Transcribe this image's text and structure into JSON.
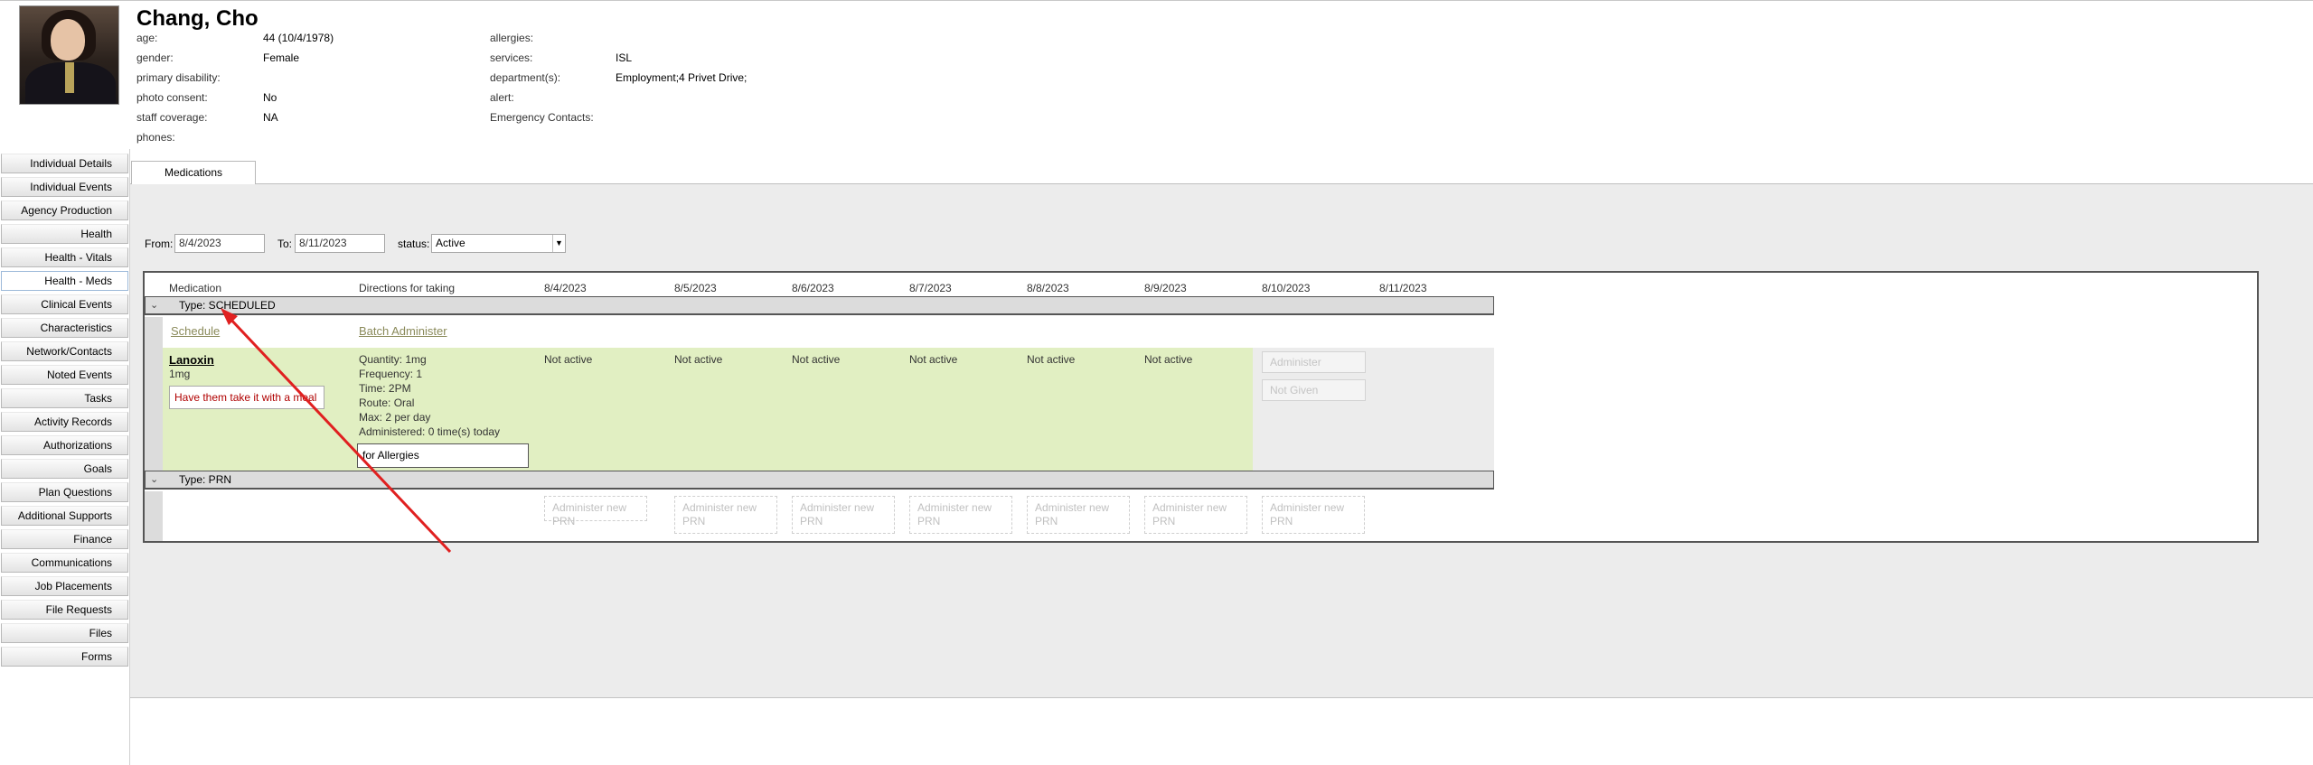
{
  "patient": {
    "name": "Chang, Cho",
    "fields_left": [
      {
        "label": "age:",
        "value": "44 (10/4/1978)"
      },
      {
        "label": "gender:",
        "value": "Female"
      },
      {
        "label": "primary disability:",
        "value": ""
      },
      {
        "label": "photo consent:",
        "value": "No"
      },
      {
        "label": "staff coverage:",
        "value": "NA"
      },
      {
        "label": "phones:",
        "value": ""
      }
    ],
    "fields_right": [
      {
        "label": "allergies:",
        "value": ""
      },
      {
        "label": "services:",
        "value": "ISL"
      },
      {
        "label": "department(s):",
        "value": "Employment;4 Privet Drive;"
      },
      {
        "label": "alert:",
        "value": ""
      },
      {
        "label": "Emergency Contacts:",
        "value": ""
      }
    ]
  },
  "nav": [
    "Individual Details",
    "Individual Events",
    "Agency Production",
    "Health",
    "Health - Vitals",
    "Health - Meds",
    "Clinical Events",
    "Characteristics",
    "Network/Contacts",
    "Noted Events",
    "Tasks",
    "Activity Records",
    "Authorizations",
    "Goals",
    "Plan Questions",
    "Additional Supports",
    "Finance",
    "Communications",
    "Job Placements",
    "File Requests",
    "Files",
    "Forms"
  ],
  "active_nav": "Health - Meds",
  "tab": {
    "label": "Medications"
  },
  "filters": {
    "from_label": "From:",
    "from_value": "8/4/2023",
    "to_label": "To:",
    "to_value": "8/11/2023",
    "status_label": "status:",
    "status_value": "Active"
  },
  "grid": {
    "columns": {
      "medication": "Medication",
      "directions": "Directions for taking"
    },
    "dates": [
      "8/4/2023",
      "8/5/2023",
      "8/6/2023",
      "8/7/2023",
      "8/8/2023",
      "8/9/2023",
      "8/10/2023",
      "8/11/2023"
    ],
    "group_scheduled": "Type: SCHEDULED",
    "schedule_link": "Schedule",
    "batch_link": "Batch Administer",
    "medication": {
      "name": "Lanoxin",
      "dose": "1mg",
      "note": "Have them take it with a meal",
      "directions": [
        "Quantity: 1mg",
        "Frequency: 1",
        "Time: 2PM",
        "Route: Oral",
        "Max: 2 per day",
        "Administered: 0 time(s) today"
      ],
      "reason": "for Allergies",
      "statuses": [
        "Not active",
        "Not active",
        "Not active",
        "Not active",
        "Not active",
        "Not active"
      ],
      "administer_label": "Administer",
      "not_given_label": "Not Given"
    },
    "group_prn": "Type: PRN",
    "prn_button_label": "Administer new PRN"
  },
  "colors": {
    "row_green": "#e1efc2",
    "note_red": "#b00000",
    "arrow": "#e02020"
  }
}
